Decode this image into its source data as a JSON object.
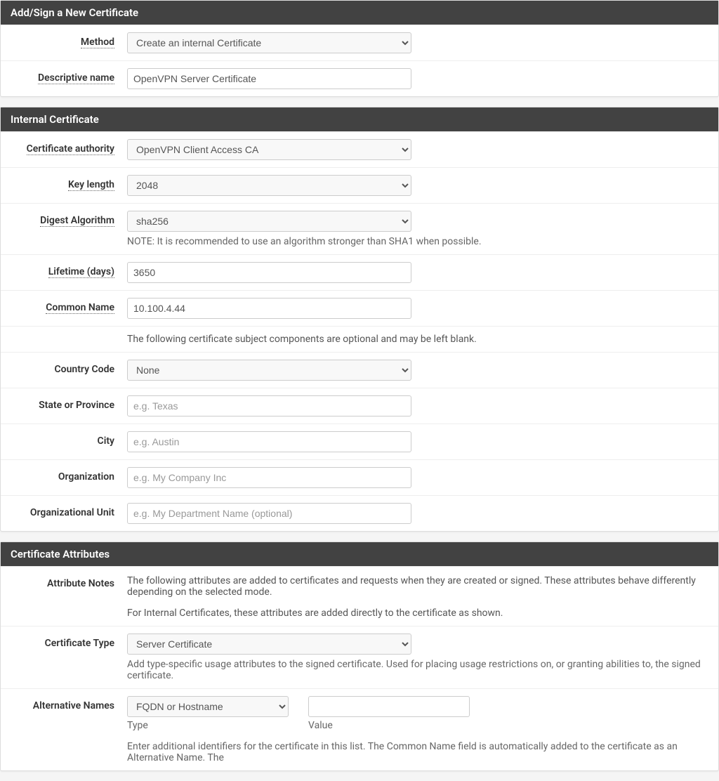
{
  "section1": {
    "title": "Add/Sign a New Certificate",
    "method": {
      "label": "Method",
      "value": "Create an internal Certificate"
    },
    "descr": {
      "label": "Descriptive name",
      "value": "OpenVPN Server Certificate"
    }
  },
  "section2": {
    "title": "Internal Certificate",
    "ca": {
      "label": "Certificate authority",
      "value": "OpenVPN Client Access CA"
    },
    "keylen": {
      "label": "Key length",
      "value": "2048"
    },
    "digest": {
      "label": "Digest Algorithm",
      "value": "sha256",
      "note": "NOTE: It is recommended to use an algorithm stronger than SHA1 when possible."
    },
    "lifetime": {
      "label": "Lifetime (days)",
      "value": "3650"
    },
    "cn": {
      "label": "Common Name",
      "value": "10.100.4.44"
    },
    "optional_intro": "The following certificate subject components are optional and may be left blank.",
    "country": {
      "label": "Country Code",
      "value": "None"
    },
    "state": {
      "label": "State or Province",
      "placeholder": "e.g. Texas"
    },
    "city": {
      "label": "City",
      "placeholder": "e.g. Austin"
    },
    "org": {
      "label": "Organization",
      "placeholder": "e.g. My Company Inc"
    },
    "ou": {
      "label": "Organizational Unit",
      "placeholder": "e.g. My Department Name (optional)"
    }
  },
  "section3": {
    "title": "Certificate Attributes",
    "notes": {
      "label": "Attribute Notes",
      "p1": "The following attributes are added to certificates and requests when they are created or signed. These attributes behave differently depending on the selected mode.",
      "p2": "For Internal Certificates, these attributes are added directly to the certificate as shown."
    },
    "cert_type": {
      "label": "Certificate Type",
      "value": "Server Certificate",
      "help": "Add type-specific usage attributes to the signed certificate. Used for placing usage restrictions on, or granting abilities to, the signed certificate."
    },
    "altnames": {
      "label": "Alternative Names",
      "type_value": "FQDN or Hostname",
      "type_sub": "Type",
      "value_sub": "Value",
      "help": "Enter additional identifiers for the certificate in this list. The Common Name field is automatically added to the certificate as an Alternative Name. The"
    }
  }
}
